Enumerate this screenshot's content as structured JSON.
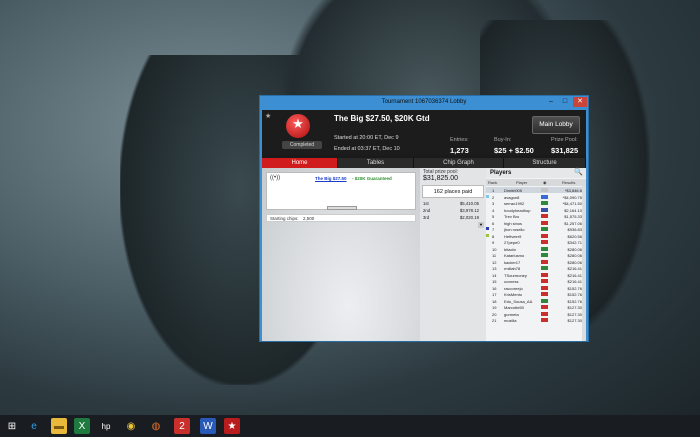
{
  "window": {
    "title": "Tournament 1067036374 Lobby",
    "controls": {
      "minimize": "–",
      "maximize": "□",
      "close": "✕"
    }
  },
  "header": {
    "name": "The Big $27.50, $20K Gtd",
    "started": "Started at 20:00 ET, Dec 9",
    "ended": "Ended at 03:37 ET, Dec 10",
    "status": "Completed",
    "entries_label": "Entries:",
    "entries_value": "1,273",
    "buyin_label": "Buy-In:",
    "buyin_value": "$25 + $2.50",
    "prizepool_label": "Prize Pool:",
    "prizepool_value": "$31,825",
    "main_lobby": "Main Lobby"
  },
  "tabs": [
    {
      "label": "Home",
      "active": true
    },
    {
      "label": "Tables",
      "active": false
    },
    {
      "label": "Chip Graph",
      "active": false
    },
    {
      "label": "Structure",
      "active": false
    }
  ],
  "home": {
    "link_name": "The Big $27.50",
    "link_sub": " - $20K Guaranteed",
    "starting_chips_label": "Starting chips:",
    "starting_chips_value": "2,500"
  },
  "prizes": {
    "total_label": "Total prize pool:",
    "total_value": "$31,825.00",
    "places_paid": "162 places paid",
    "payouts": [
      {
        "place": "1st",
        "amount": "$5,410.05"
      },
      {
        "place": "2nd",
        "amount": "$3,978.12"
      },
      {
        "place": "3rd",
        "amount": "$2,020.19"
      }
    ]
  },
  "players": {
    "title": "Players",
    "col_rank": "Rank",
    "col_player": "Player",
    "col_results": "Results",
    "rows": [
      {
        "rank": "1",
        "name": "Dimitri005",
        "result": "*$3,846.6",
        "flag": "#c4c4c4",
        "mark": ""
      },
      {
        "rank": "2",
        "name": "avagon8",
        "result": "*$4,090.75",
        "flag": "#3a6ad8",
        "mark": "#7fc8e8"
      },
      {
        "rank": "3",
        "name": "serrao1992",
        "result": "*$4,471.50",
        "flag": "#2e8a3a",
        "mark": ""
      },
      {
        "rank": "4",
        "name": "hoodyheadhop",
        "result": "$2,164.10",
        "flag": "#3a4fa8",
        "mark": ""
      },
      {
        "rank": "5",
        "name": "Trev Bro",
        "result": "$1,575.33",
        "flag": "#c9302c",
        "mark": ""
      },
      {
        "rank": "6",
        "name": "high sinos",
        "result": "$1,257.06",
        "flag": "#c9302c",
        "mark": ""
      },
      {
        "rank": "7",
        "name": "jhon rosello",
        "result": "$936.83",
        "flag": "#2e8a3a",
        "mark": "#2c3ab8"
      },
      {
        "rank": "8",
        "name": "Heftveer9",
        "result": "$620.56",
        "flag": "#c9302c",
        "mark": "#9ac23a"
      },
      {
        "rank": "9",
        "name": "27pepe0",
        "result": "$342.71",
        "flag": "#c9302c",
        "mark": ""
      },
      {
        "rank": "10",
        "name": "bitacbr",
        "result": "$280.06",
        "flag": "#2e8a3a",
        "mark": ""
      },
      {
        "rank": "11",
        "name": "Katarlusmo",
        "result": "$280.06",
        "flag": "#2e8a3a",
        "mark": ""
      },
      {
        "rank": "12",
        "name": "kacker17",
        "result": "$280.06",
        "flag": "#c9302c",
        "mark": ""
      },
      {
        "rank": "13",
        "name": "rmiliah78",
        "result": "$216.41",
        "flag": "#2e8a3a",
        "mark": ""
      },
      {
        "rank": "14",
        "name": "TSourmoney",
        "result": "$216.41",
        "flag": "#c9302c",
        "mark": ""
      },
      {
        "rank": "15",
        "name": "ccxness",
        "result": "$216.41",
        "flag": "#c9302c",
        "mark": ""
      },
      {
        "rank": "16",
        "name": "raccoreejo",
        "result": "$152.76",
        "flag": "#c9302c",
        "mark": ""
      },
      {
        "rank": "17",
        "name": "KrisMento",
        "result": "$152.76",
        "flag": "#c9302c",
        "mark": ""
      },
      {
        "rank": "18",
        "name": "Edu_Sousa_AA",
        "result": "$152.76",
        "flag": "#2e8a3a",
        "mark": ""
      },
      {
        "rank": "19",
        "name": "Marcotte50",
        "result": "$127.30",
        "flag": "#c9302c",
        "mark": ""
      },
      {
        "rank": "20",
        "name": "gurmeta",
        "result": "$127.30",
        "flag": "#c9302c",
        "mark": ""
      },
      {
        "rank": "21",
        "name": "mozilla",
        "result": "$127.30",
        "flag": "#c9302c",
        "mark": ""
      }
    ]
  },
  "taskbar": {
    "icons": [
      {
        "name": "windows-start-icon",
        "glyph": "⊞",
        "bg": "transparent",
        "fg": "#ffffff"
      },
      {
        "name": "internet-explorer-icon",
        "glyph": "e",
        "bg": "transparent",
        "fg": "#2fa2e8"
      },
      {
        "name": "file-explorer-icon",
        "glyph": "▬",
        "bg": "#e8b93a",
        "fg": "#7a5a12"
      },
      {
        "name": "excel-icon",
        "glyph": "X",
        "bg": "#1e7a3e",
        "fg": "#ffffff"
      },
      {
        "name": "hp-icon",
        "glyph": "hp",
        "bg": "transparent",
        "fg": "#ffffff"
      },
      {
        "name": "chrome-icon",
        "glyph": "◉",
        "bg": "transparent",
        "fg": "#e8c43a"
      },
      {
        "name": "firefox-icon",
        "glyph": "◍",
        "bg": "transparent",
        "fg": "#e8732a"
      },
      {
        "name": "app-two-icon",
        "glyph": "2",
        "bg": "#c9302c",
        "fg": "#ffffff"
      },
      {
        "name": "word-icon",
        "glyph": "W",
        "bg": "#2a5ab8",
        "fg": "#ffffff"
      },
      {
        "name": "pokerstars-icon",
        "glyph": "★",
        "bg": "#b81c1c",
        "fg": "#ffffff"
      }
    ]
  }
}
